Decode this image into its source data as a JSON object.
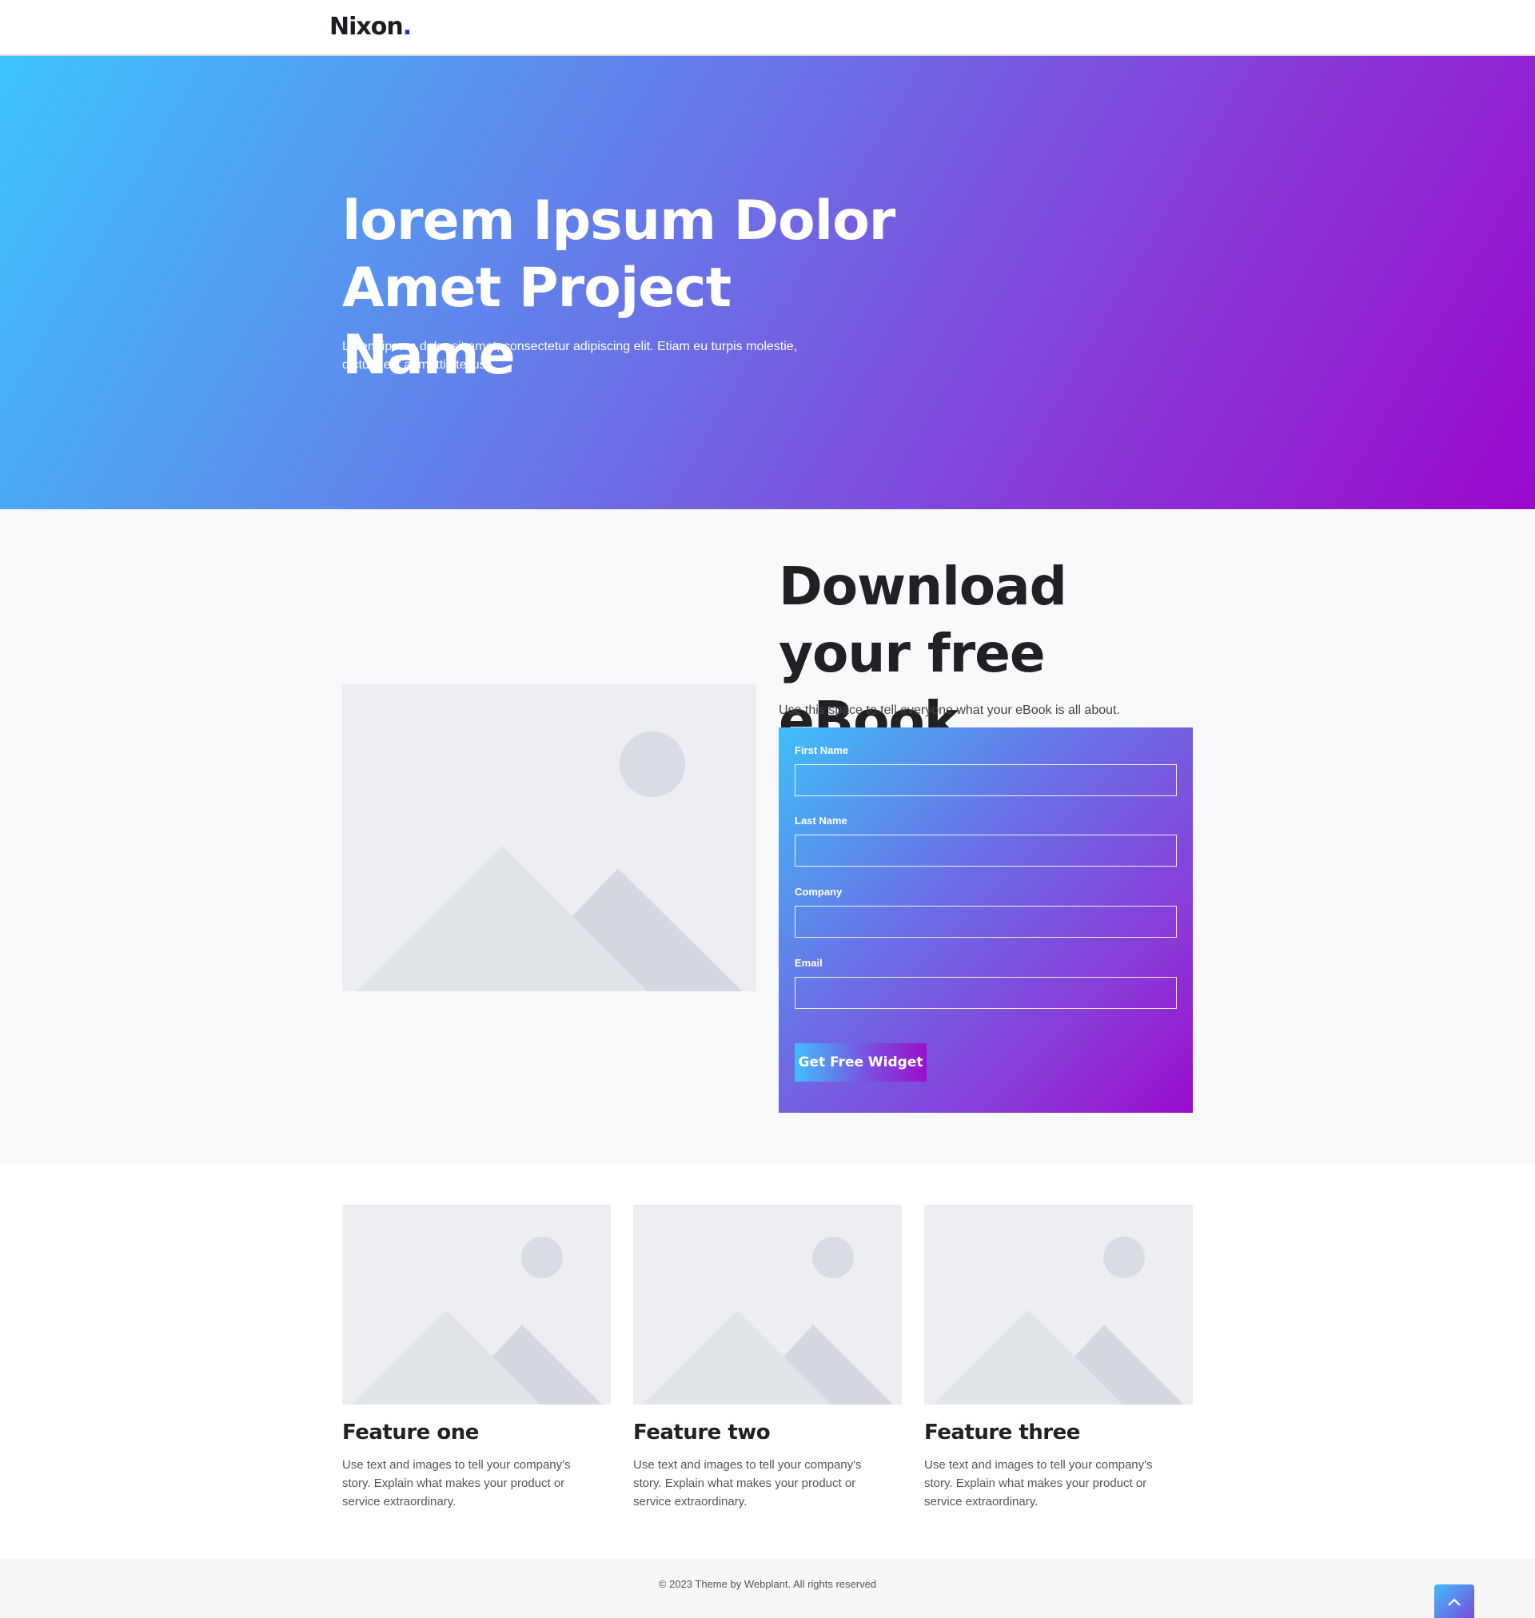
{
  "header": {
    "logo_text": "Nixon",
    "logo_dot": "."
  },
  "hero": {
    "title": "lorem Ipsum Dolor Amet Project Name",
    "subtitle": "Lorem ipsum dolor sit amet, consectetur adipiscing elit. Etiam eu turpis molestie, dictum est a, mattis tellus."
  },
  "ebook": {
    "title": "Download your free eBook",
    "description": "Use this space to tell everyone what your eBook is all about.",
    "form": {
      "first_name_label": "First Name",
      "last_name_label": "Last Name",
      "company_label": "Company",
      "email_label": "Email",
      "submit_label": "Get Free Widget"
    }
  },
  "features": [
    {
      "title": "Feature one",
      "text": "Use text and images to tell your company's story. Explain what makes your product or service extraordinary."
    },
    {
      "title": "Feature two",
      "text": "Use text and images to tell your company's story. Explain what makes your product or service extraordinary."
    },
    {
      "title": "Feature three",
      "text": "Use text and images to tell your company's story. Explain what makes your product or service extraordinary."
    }
  ],
  "footer": {
    "copyright": "© 2023 Theme by Webplant. All rights reserved",
    "to_top_icon": "chevron-up-icon"
  },
  "colors": {
    "gradient_start": "#3dc4fc",
    "gradient_mid": "#6a72e6",
    "gradient_end": "#9a08cc",
    "logo_dot": "#1b2bd6"
  }
}
